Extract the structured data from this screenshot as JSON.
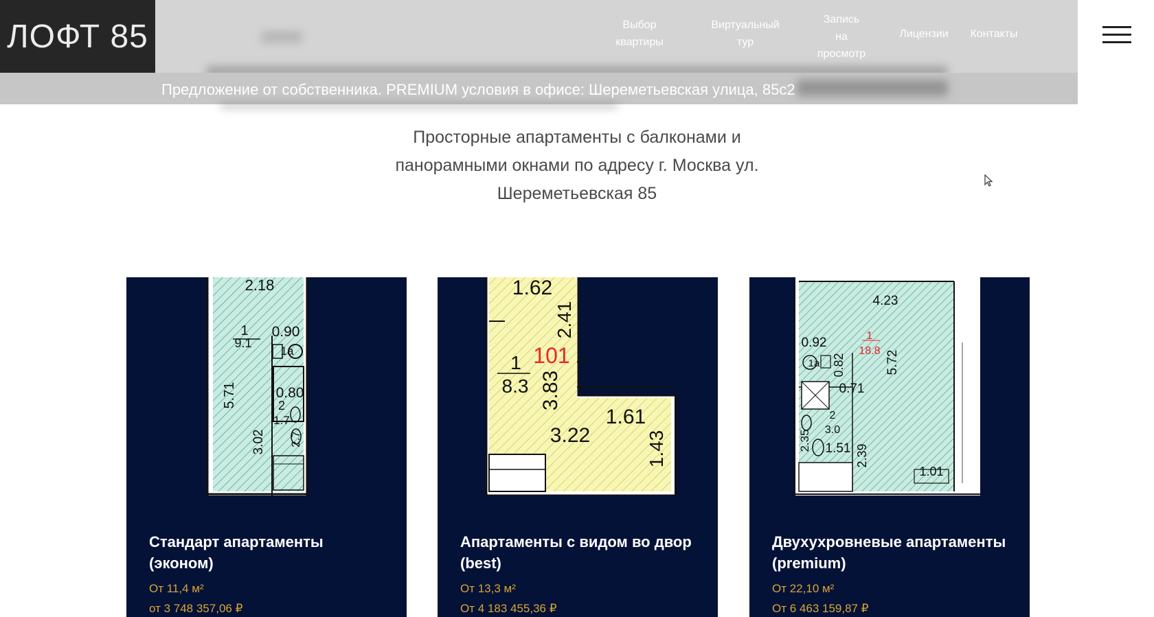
{
  "header": {
    "logo": "ЛОФТ 85",
    "nav": [
      {
        "line1": "Выбор",
        "line2": "квартиры"
      },
      {
        "line1": "Виртуальный",
        "line2": "тур"
      },
      {
        "line1": "Запись",
        "line2": "на",
        "line3": "просмотр"
      },
      {
        "line1": "Лицензии"
      },
      {
        "line1": "Контакты"
      }
    ],
    "menu_icon": "hamburger-icon"
  },
  "promo": {
    "text": "Предложение от собственника. PREMIUM условия в офисе: Шереметьевская улица, 85с2"
  },
  "subtitle": {
    "line1": "Просторные апартаменты с балконами и",
    "line2": "панорамными окнами по адресу г. Москва ул.",
    "line3": "Шереметьевская 85"
  },
  "cards": [
    {
      "title_line1": "Стандарт апартаменты",
      "title_line2": "(эконом)",
      "area": "От 11,4 м²",
      "price": "от 3 748 357,06 ₽",
      "plan_labels": {
        "a": "2.18",
        "b": "1",
        "c": "9.1",
        "d": "0.90",
        "e": "1а",
        "f": "5.71",
        "g": "0.80",
        "h": "2",
        "i": "1.7",
        "j": "3.02",
        "k": "2.7"
      }
    },
    {
      "title_line1": "Апартаменты с видом во двор",
      "title_line2": "(best)",
      "area": "От 13,3 м²",
      "price": "От 4 183 455,36 ₽",
      "plan_labels": {
        "a": "1.62",
        "b": "2.41",
        "c": "101",
        "d": "1",
        "e": "8.3",
        "f": "3.83",
        "g": "1.61",
        "h": "3.22",
        "i": "1.43"
      }
    },
    {
      "title_line1": "Двухухровневые апартаменты",
      "title_line2": "(premium)",
      "area": "От 22,10 м²",
      "price": "От 6 463 159,87 ₽",
      "plan_labels": {
        "a": "4.23",
        "b": "0.92",
        "c": "1",
        "d": "18.8",
        "e": "1а",
        "f": "0.82",
        "g": "5.72",
        "h": "0.71",
        "i": "2",
        "j": "3.0",
        "k": "2.35",
        "l": "1.51",
        "m": "2.39",
        "n": "1.01"
      }
    }
  ],
  "colors": {
    "header_bg": "#d4d4d4",
    "logo_bg": "#262626",
    "card_bg": "#041237",
    "price_text": "#d9a437",
    "plan_green": "#c9ebe1",
    "plan_yellow": "#f8f6b4",
    "plan_red": "#e8262d"
  }
}
